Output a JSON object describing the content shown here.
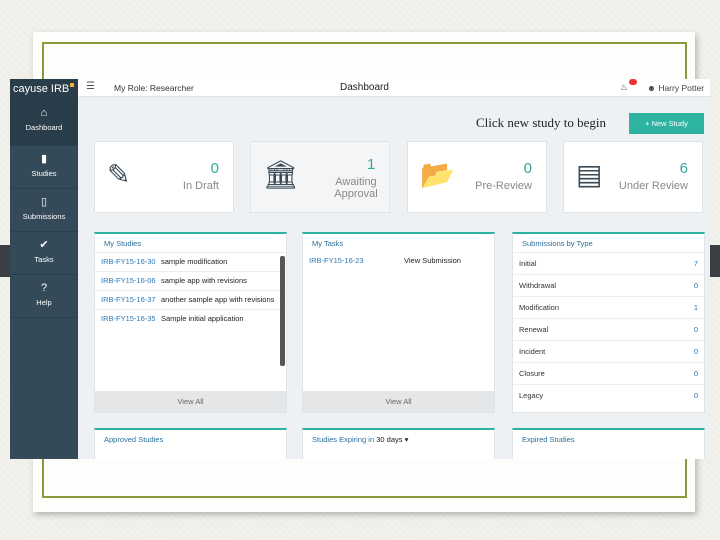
{
  "app": {
    "logo": "cayuse IRB",
    "role_label": "My Role: Researcher",
    "page_title": "Dashboard",
    "user_name": "Harry Potter"
  },
  "sidebar": {
    "items": [
      {
        "label": "Dashboard",
        "icon": "home-icon"
      },
      {
        "label": "Studies",
        "icon": "folder-icon"
      },
      {
        "label": "Submissions",
        "icon": "document-icon"
      },
      {
        "label": "Tasks",
        "icon": "checkmark-icon"
      },
      {
        "label": "Help",
        "icon": "question-icon"
      }
    ]
  },
  "hint_text": "Click new study to begin",
  "new_study_label": "+ New Study",
  "stats": [
    {
      "count": "0",
      "label": "In Draft",
      "icon": "pencil-icon"
    },
    {
      "count": "1",
      "label": "Awaiting Approval",
      "icon": "institution-icon"
    },
    {
      "count": "0",
      "label": "Pre-Review",
      "icon": "folder-open-icon"
    },
    {
      "count": "6",
      "label": "Under Review",
      "icon": "list-icon"
    }
  ],
  "my_studies": {
    "title": "My Studies",
    "rows": [
      {
        "id": "IRB-FY15-16-30",
        "name": "sample modification"
      },
      {
        "id": "IRB-FY15-16-06",
        "name": "sample app with revisions"
      },
      {
        "id": "IRB-FY15-16-37",
        "name": "another sample app with revisions"
      },
      {
        "id": "IRB-FY15-16-35",
        "name": "Sample initial application"
      }
    ],
    "view_all": "View All"
  },
  "my_tasks": {
    "title": "My Tasks",
    "rows": [
      {
        "id": "IRB-FY15-16-23",
        "action": "View Submission"
      }
    ],
    "view_all": "View All"
  },
  "submissions_by_type": {
    "title": "Submissions by Type",
    "rows": [
      {
        "type": "Initial",
        "count": "7"
      },
      {
        "type": "Withdrawal",
        "count": "0"
      },
      {
        "type": "Modification",
        "count": "1"
      },
      {
        "type": "Renewal",
        "count": "0"
      },
      {
        "type": "Incident",
        "count": "0"
      },
      {
        "type": "Closure",
        "count": "0"
      },
      {
        "type": "Legacy",
        "count": "0"
      }
    ]
  },
  "bottom_panels": {
    "approved": "Approved Studies",
    "expiring": "Studies Expiring in",
    "expiring_range": "30 days",
    "expired": "Expired Studies"
  },
  "colors": {
    "accent": "#2fb3a1",
    "sidebar": "#344a59",
    "link": "#2b77b6"
  }
}
